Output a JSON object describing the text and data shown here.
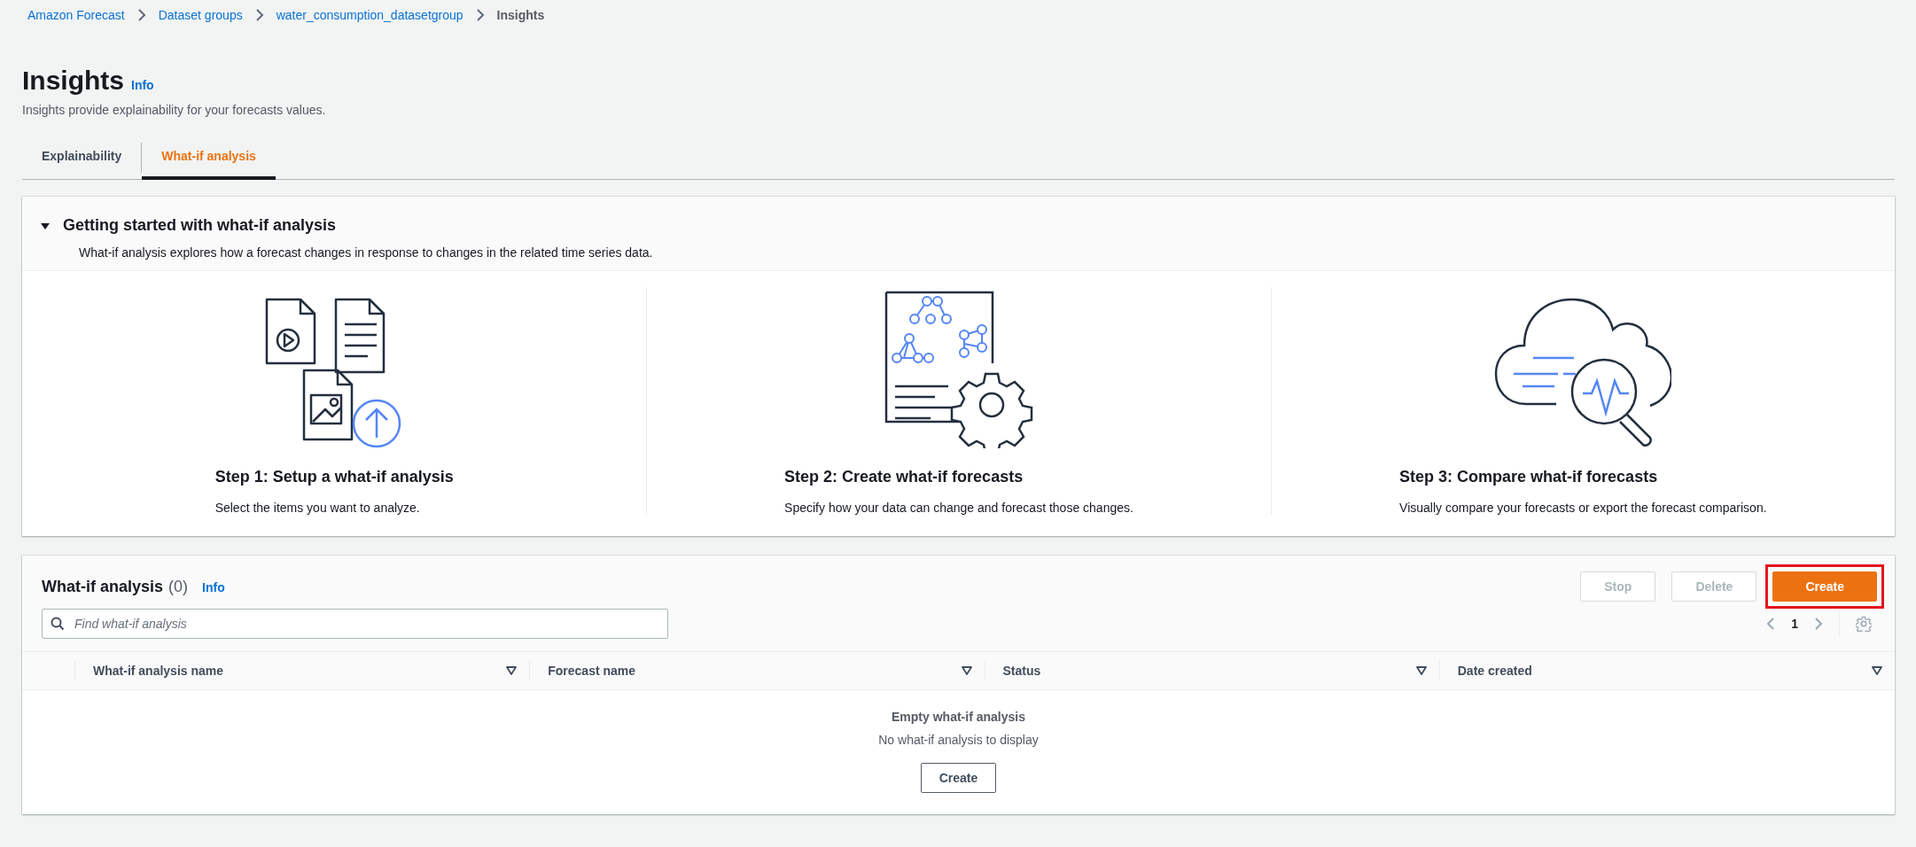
{
  "breadcrumbs": [
    {
      "label": "Amazon Forecast",
      "kind": "link"
    },
    {
      "label": "Dataset groups",
      "kind": "link"
    },
    {
      "label": "water_consumption_datasetgroup",
      "kind": "link"
    },
    {
      "label": "Insights",
      "kind": "current"
    }
  ],
  "header": {
    "title": "Insights",
    "info": "Info",
    "description": "Insights provide explainability for your forecasts values."
  },
  "tabs": [
    {
      "label": "Explainability",
      "selected": false
    },
    {
      "label": "What-if analysis",
      "selected": true
    }
  ],
  "getting_started": {
    "expanded": true,
    "title": "Getting started with what-if analysis",
    "description": "What-if analysis explores how a forecast changes in response to changes in the related time series data.",
    "steps": [
      {
        "kind": "setup",
        "title": "Step 1: Setup a what-if analysis",
        "description": "Select the items you want to analyze."
      },
      {
        "kind": "create",
        "title": "Step 2: Create what-if forecasts",
        "description": "Specify how your data can change and forecast those changes."
      },
      {
        "kind": "compare",
        "title": "Step 3: Compare what-if forecasts",
        "description": "Visually compare your forecasts or export the forecast comparison."
      }
    ]
  },
  "analysis_table": {
    "title": "What-if analysis",
    "count": "(0)",
    "info": "Info",
    "buttons": [
      {
        "label": "Stop",
        "kind": "normal",
        "disabled": true,
        "highlighted": false
      },
      {
        "label": "Delete",
        "kind": "normal",
        "disabled": true,
        "highlighted": false
      },
      {
        "label": "Create",
        "kind": "primary",
        "disabled": false,
        "highlighted": true
      }
    ],
    "search": {
      "placeholder": "Find what-if analysis"
    },
    "pagination": {
      "page": "1"
    },
    "columns": [
      "What-if analysis name",
      "Forecast name",
      "Status",
      "Date created"
    ],
    "empty": {
      "title": "Empty what-if analysis",
      "message": "No what-if analysis to display",
      "button": "Create"
    }
  }
}
